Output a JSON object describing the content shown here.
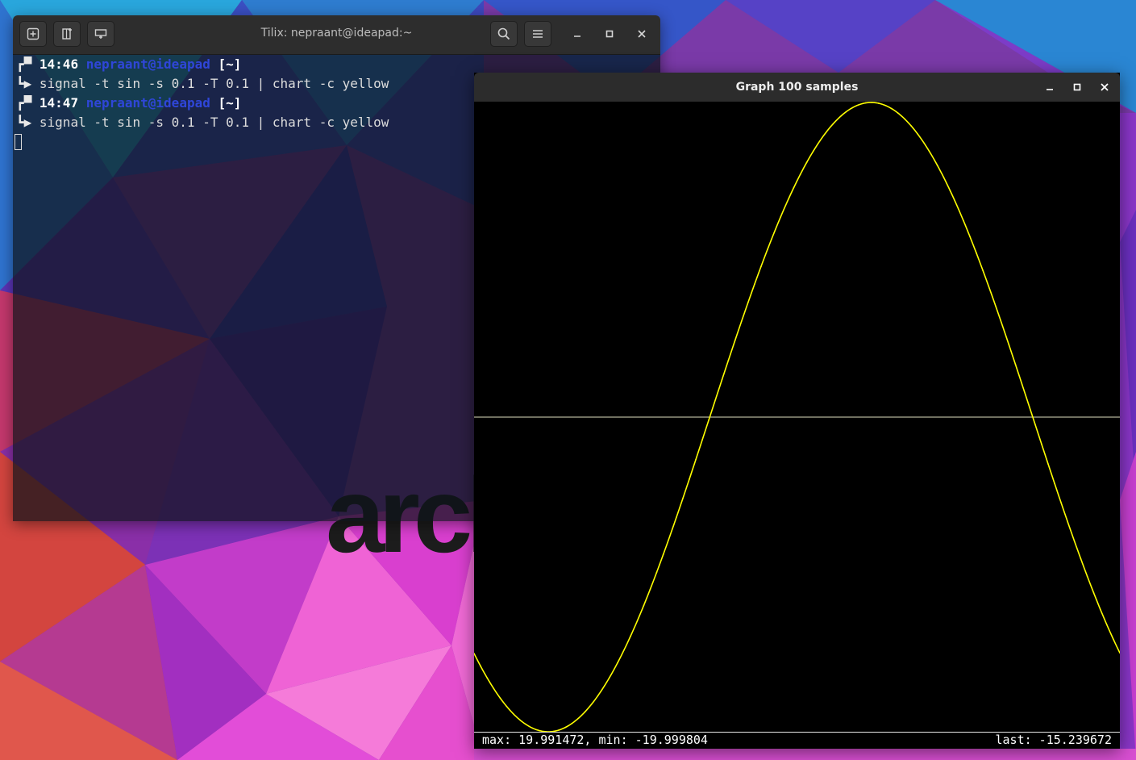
{
  "wallpaper": {
    "logo_text": "arch",
    "colors": [
      "#1fa3d9",
      "#2d6fd0",
      "#6a38c6",
      "#9a2ec0",
      "#e83fd6",
      "#f25ccf",
      "#c43a6e",
      "#f0604a"
    ]
  },
  "terminal": {
    "title": "Tilix: nepraant@ideapad:~",
    "toolbar": {
      "add_terminal_icon": "add-terminal-icon",
      "split_icon": "split-terminal-icon",
      "session_icon": "session-icon",
      "search_icon": "search-icon",
      "menu_icon": "hamburger-menu-icon"
    },
    "lines": [
      {
        "kind": "prompt",
        "glyph": "┏▀",
        "time": "14:46",
        "userhost": "nepraant@ideapad",
        "cwd": "[~]"
      },
      {
        "kind": "command",
        "glyph": "┗▶",
        "text": "signal -t sin -s 0.1 -T 0.1 | chart -c yellow"
      },
      {
        "kind": "prompt",
        "glyph": "┏▀",
        "time": "14:47",
        "userhost": "nepraant@ideapad",
        "cwd": "[~]"
      },
      {
        "kind": "command",
        "glyph": "┗▶",
        "text": "signal -t sin -s 0.1 -T 0.1 | chart -c yellow"
      }
    ]
  },
  "graph_window": {
    "title": "Graph 100 samples",
    "status": {
      "left": "max: 19.991472, min: -19.999804",
      "right": "last: -15.239672"
    }
  },
  "chart_data": {
    "type": "line",
    "color": "#ffff00",
    "axis_color": "#e0e0c0",
    "samples": 100,
    "ylim": [
      -20,
      20
    ],
    "series": [
      {
        "function": "20*sin(2*pi*0.34*(t - 0.138))",
        "t_range": [
          0,
          1
        ],
        "points": 100
      }
    ],
    "max": 19.991472,
    "min": -19.999804,
    "last": -15.239672
  }
}
